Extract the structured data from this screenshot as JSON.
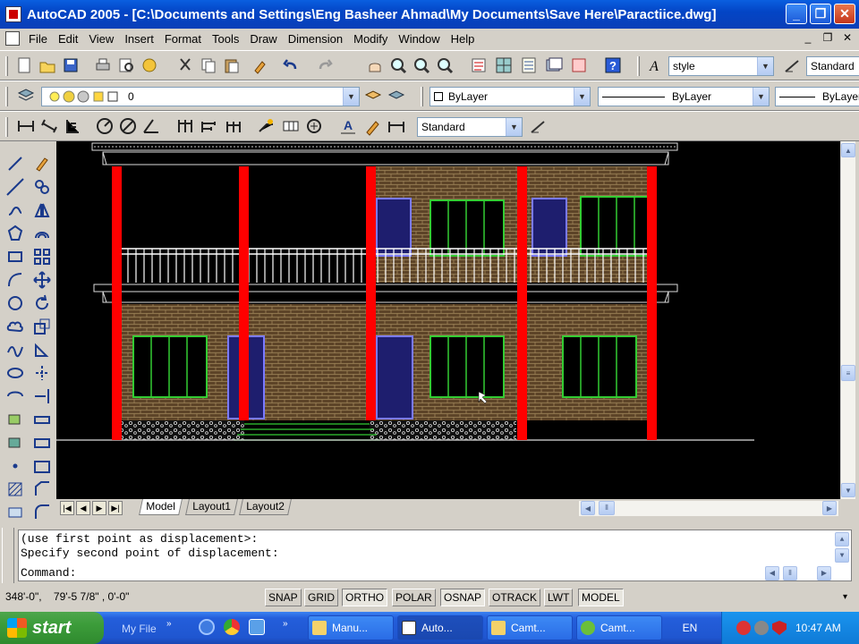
{
  "window": {
    "title": "AutoCAD 2005 - [C:\\Documents and Settings\\Eng Basheer Ahmad\\My Documents\\Save Here\\Paractiice.dwg]",
    "minimize_glyph": "_",
    "maximize_glyph": "❐",
    "close_glyph": "✕"
  },
  "menu": [
    "File",
    "Edit",
    "View",
    "Insert",
    "Format",
    "Tools",
    "Draw",
    "Dimension",
    "Modify",
    "Window",
    "Help"
  ],
  "mdi_controls": [
    "_",
    "❐",
    "✕"
  ],
  "toolbars": {
    "text_style_icon": "A",
    "text_style": "style",
    "dim_style": "Standard",
    "layer": "0",
    "color": "ByLayer",
    "linetype": "ByLayer",
    "lineweight": "ByLayer",
    "dim_style_2": "Standard"
  },
  "tabs": [
    "Model",
    "Layout1",
    "Layout2"
  ],
  "command_window": {
    "lines": [
      "(use first point as displacement>:",
      "Specify second point of displacement:",
      "Command:"
    ]
  },
  "status": {
    "coords": "348'-0\",    79'-5 7/8\" , 0'-0\"",
    "toggles": [
      {
        "label": "SNAP",
        "on": false
      },
      {
        "label": "GRID",
        "on": false
      },
      {
        "label": "ORTHO",
        "on": true
      },
      {
        "label": "POLAR",
        "on": false
      },
      {
        "label": "OSNAP",
        "on": true
      },
      {
        "label": "OTRACK",
        "on": false
      },
      {
        "label": "LWT",
        "on": false
      },
      {
        "label": "MODEL",
        "on": true
      }
    ]
  },
  "taskbar": {
    "start_label": "start",
    "quicklaunch_label": "My File",
    "buttons": [
      {
        "label": "Manu...",
        "icon": "folder-icon"
      },
      {
        "label": "Auto...",
        "icon": "autocad-icon",
        "active": true
      },
      {
        "label": "Camt...",
        "icon": "folder-icon"
      },
      {
        "label": "Camt...",
        "icon": "camtasia-icon"
      }
    ],
    "language": "EN",
    "clock": "10:47 AM"
  },
  "colors": {
    "column": "#ff0000",
    "brick": "#6b5234",
    "window_frame": "#33cc33",
    "door": "#2b2b8c",
    "railing": "#ffffff"
  }
}
